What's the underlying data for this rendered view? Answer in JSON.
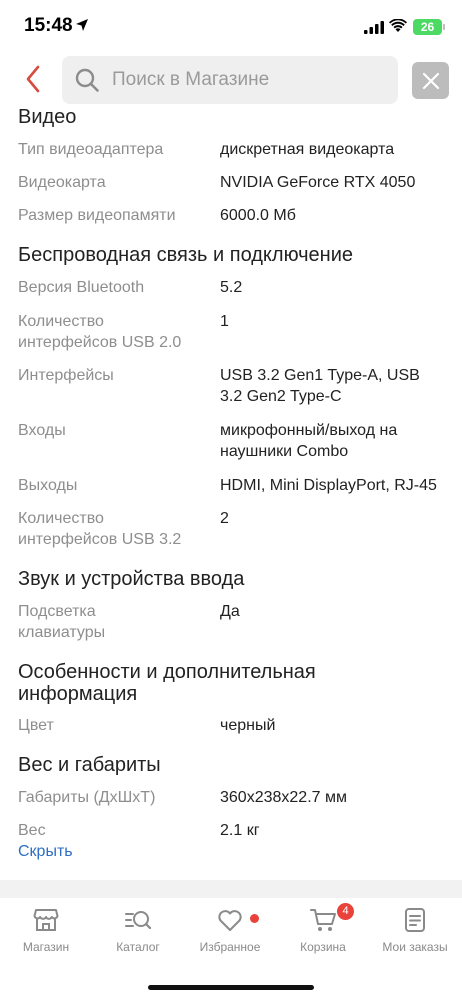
{
  "status": {
    "time": "15:48",
    "battery": "26"
  },
  "search": {
    "placeholder": "Поиск в Магазине"
  },
  "sections": {
    "video": {
      "title": "Видео",
      "rows": [
        {
          "label": "Тип видеоадаптера",
          "value": "дискретная видеокарта"
        },
        {
          "label": "Видеокарта",
          "value": "NVIDIA GeForce RTX 4050"
        },
        {
          "label": "Размер видеопамяти",
          "value": "6000.0 Мб"
        }
      ]
    },
    "wireless": {
      "title": "Беспроводная связь и подключение",
      "rows": [
        {
          "label": "Версия Bluetooth",
          "value": "5.2"
        },
        {
          "label": "Количество интерфейсов USB 2.0",
          "value": "1"
        },
        {
          "label": "Интерфейсы",
          "value": "USB 3.2 Gen1 Type-A, USB 3.2 Gen2 Type-C"
        },
        {
          "label": "Входы",
          "value": "микрофонный/выход на наушники Combo"
        },
        {
          "label": "Выходы",
          "value": "HDMI, Mini DisplayPort, RJ-45"
        },
        {
          "label": "Количество интерфейсов USB 3.2",
          "value": "2"
        }
      ]
    },
    "sound": {
      "title": "Звук и устройства ввода",
      "rows": [
        {
          "label": "Подсветка клавиатуры",
          "value": "Да"
        }
      ]
    },
    "extra": {
      "title": "Особенности и дополнительная информация",
      "rows": [
        {
          "label": "Цвет",
          "value": "черный"
        }
      ]
    },
    "weight": {
      "title": "Вес и габариты",
      "rows": [
        {
          "label": "Габариты (ДхШхТ)",
          "value": "360x238x22.7 мм"
        },
        {
          "label": "Вес",
          "value": "2.1 кг"
        }
      ]
    }
  },
  "hide_link": "Скрыть",
  "tabbar": {
    "items": [
      {
        "label": "Магазин",
        "icon": "shop-icon"
      },
      {
        "label": "Каталог",
        "icon": "catalog-icon"
      },
      {
        "label": "Избранное",
        "icon": "heart-icon"
      },
      {
        "label": "Корзина",
        "icon": "cart-icon",
        "badge": "4"
      },
      {
        "label": "Мои заказы",
        "icon": "orders-icon"
      }
    ]
  },
  "colors": {
    "accent": "#d84b3f",
    "link": "#2d6fc2",
    "badge": "#e8423a",
    "battery": "#4cd964"
  }
}
